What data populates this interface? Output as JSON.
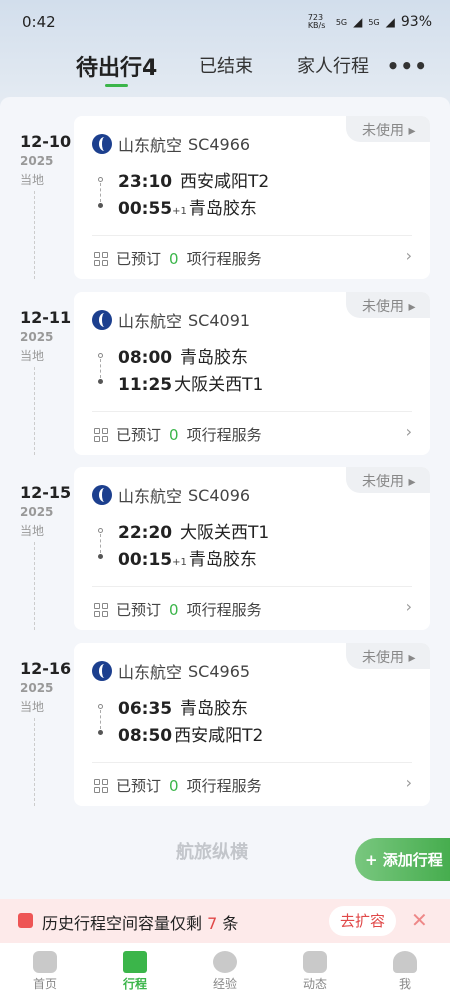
{
  "status": {
    "time": "0:42",
    "net_speed": "723 KB/s",
    "signal1": "5G",
    "signal2": "5G",
    "battery": "93%"
  },
  "tabs": [
    {
      "label": "待出行4",
      "active": true
    },
    {
      "label": "已结束"
    },
    {
      "label": "家人行程"
    }
  ],
  "more_label": "•••",
  "trips": [
    {
      "date": "12-10",
      "year": "2025",
      "tz": "当地",
      "status": "未使用 ▸",
      "airline": "山东航空",
      "flight": "SC4966",
      "dep_time": "23:10",
      "dep_airport": "西安咸阳T2",
      "arr_time": "00:55",
      "arr_plus": "+1",
      "arr_airport": "青岛胶东",
      "svc_pre": "已预订",
      "svc_count": "0",
      "svc_post": "项行程服务"
    },
    {
      "date": "12-11",
      "year": "2025",
      "tz": "当地",
      "status": "未使用 ▸",
      "airline": "山东航空",
      "flight": "SC4091",
      "dep_time": "08:00",
      "dep_airport": "青岛胶东",
      "arr_time": "11:25",
      "arr_plus": "",
      "arr_airport": "大阪关西T1",
      "svc_pre": "已预订",
      "svc_count": "0",
      "svc_post": "项行程服务"
    },
    {
      "date": "12-15",
      "year": "2025",
      "tz": "当地",
      "status": "未使用 ▸",
      "airline": "山东航空",
      "flight": "SC4096",
      "dep_time": "22:20",
      "dep_airport": "大阪关西T1",
      "arr_time": "00:15",
      "arr_plus": "+1",
      "arr_airport": "青岛胶东",
      "svc_pre": "已预订",
      "svc_count": "0",
      "svc_post": "项行程服务"
    },
    {
      "date": "12-16",
      "year": "2025",
      "tz": "当地",
      "status": "未使用 ▸",
      "airline": "山东航空",
      "flight": "SC4965",
      "dep_time": "06:35",
      "dep_airport": "青岛胶东",
      "arr_time": "08:50",
      "arr_plus": "",
      "arr_airport": "西安咸阳T2",
      "svc_pre": "已预订",
      "svc_count": "0",
      "svc_post": "项行程服务"
    }
  ],
  "brand": "航旅纵横",
  "add_trip": "+ 添加行程",
  "banner": {
    "text": "历史行程空间容量仅剩",
    "count": "7",
    "unit": "条",
    "action": "去扩容",
    "close": "✕"
  },
  "nav": [
    {
      "label": "首页"
    },
    {
      "label": "行程",
      "active": true
    },
    {
      "label": "经验"
    },
    {
      "label": "动态"
    },
    {
      "label": "我"
    }
  ],
  "colors": {
    "accent": "#3bb54a",
    "warning": "#e04848"
  }
}
